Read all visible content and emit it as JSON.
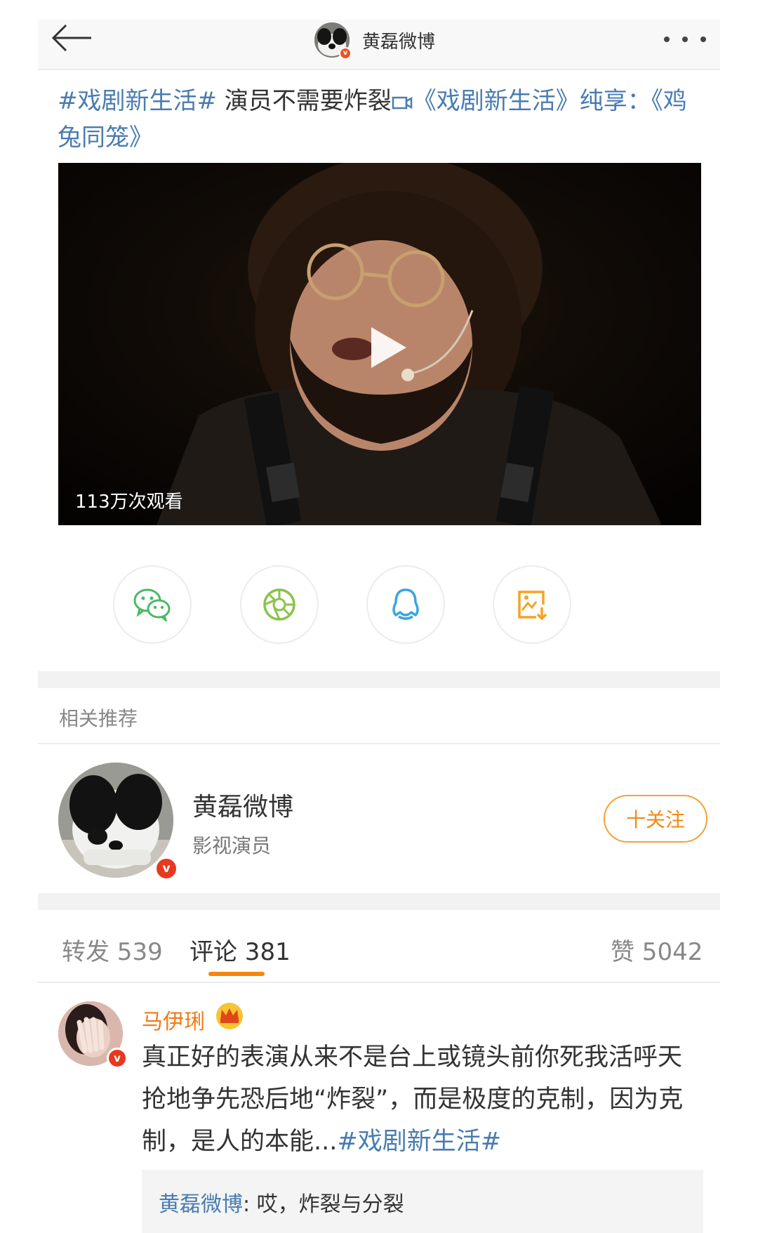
{
  "header": {
    "title": "黄磊微博"
  },
  "post": {
    "hashtag": "#戏剧新生活#",
    "text": " 演员不需要炸裂",
    "link_text": "《戏剧新生活》纯享：《鸡兔同笼》",
    "video_views": "113万次观看"
  },
  "share": {
    "wechat": "wechat-icon",
    "moments": "moments-icon",
    "qq": "qq-icon",
    "save": "save-image-icon"
  },
  "recommend": {
    "section_label": "相关推荐",
    "name": "黄磊微博",
    "subtitle": "影视演员",
    "follow_label": "十关注"
  },
  "tabs": {
    "repost": "转发 539",
    "comment": "评论 381",
    "like": "赞 5042"
  },
  "comment": {
    "author": "马伊琍",
    "text": "真正好的表演从来不是台上或镜头前你死我活呼天抢地争先恐后地“炸裂”，而是极度的克制，因为克制，是人的本能...",
    "hashtag": "#戏剧新生活#",
    "reply_author": "黄磊微博",
    "reply_text": ": 哎，炸裂与分裂"
  },
  "colors": {
    "link_blue": "#4a7cb0",
    "accent_orange": "#f5860e",
    "verified_red": "#e8381e"
  }
}
